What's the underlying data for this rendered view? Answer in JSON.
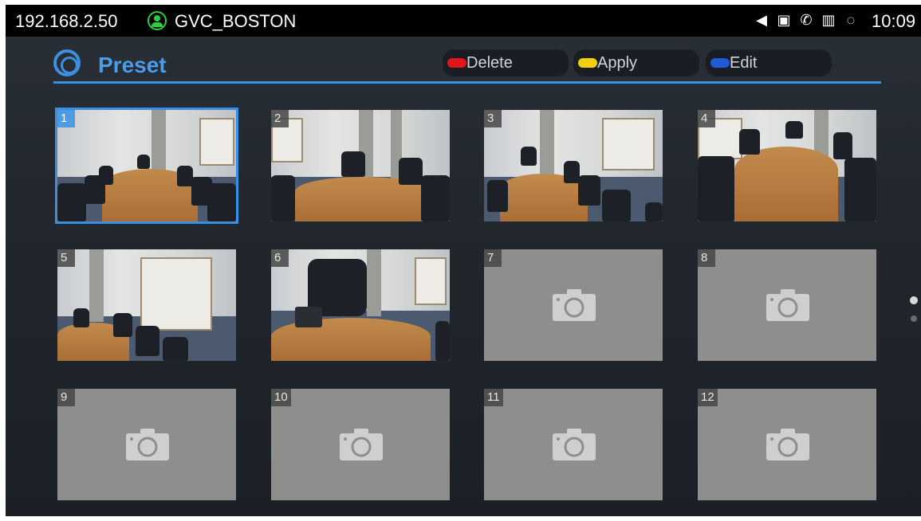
{
  "status_bar": {
    "ip": "192.168.2.50",
    "account": "GVC_BOSTON",
    "icons": [
      "speaker-icon",
      "voicemail-icon",
      "call-icon",
      "remote-icon",
      "sync-icon"
    ],
    "time": "10:09"
  },
  "header": {
    "title": "Preset",
    "buttons": [
      {
        "label": "Delete",
        "color": "#e0161b"
      },
      {
        "label": "Apply",
        "color": "#f2d00f"
      },
      {
        "label": "Edit",
        "color": "#1f5bd6"
      }
    ]
  },
  "presets": [
    {
      "number": "1",
      "has_image": true,
      "selected": true
    },
    {
      "number": "2",
      "has_image": true,
      "selected": false
    },
    {
      "number": "3",
      "has_image": true,
      "selected": false
    },
    {
      "number": "4",
      "has_image": true,
      "selected": false
    },
    {
      "number": "5",
      "has_image": true,
      "selected": false
    },
    {
      "number": "6",
      "has_image": true,
      "selected": false
    },
    {
      "number": "7",
      "has_image": false,
      "selected": false
    },
    {
      "number": "8",
      "has_image": false,
      "selected": false
    },
    {
      "number": "9",
      "has_image": false,
      "selected": false
    },
    {
      "number": "10",
      "has_image": false,
      "selected": false
    },
    {
      "number": "11",
      "has_image": false,
      "selected": false
    },
    {
      "number": "12",
      "has_image": false,
      "selected": false
    }
  ],
  "pager": {
    "pages": 2,
    "current": 1
  },
  "colors": {
    "accent": "#3d8fe0",
    "title": "#4a9ce8",
    "account_icon": "#2ecc40"
  }
}
